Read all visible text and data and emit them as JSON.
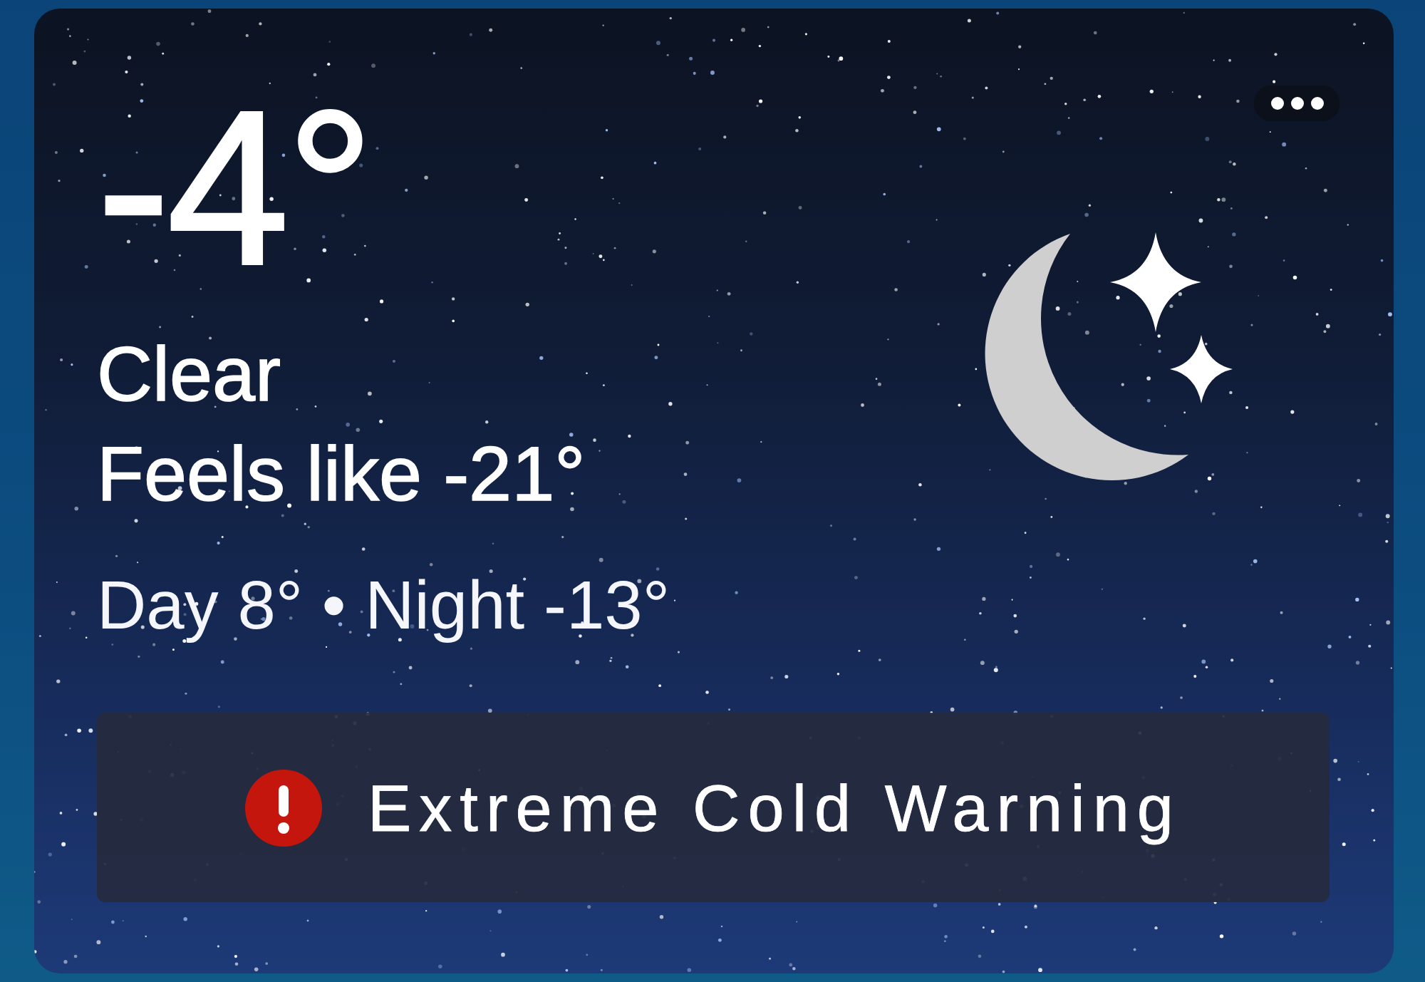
{
  "weather": {
    "temperature": "-4°",
    "condition": "Clear",
    "feels_like": "Feels like -21°",
    "day_night": "Day 8° • Night -13°"
  },
  "alert": {
    "title": "Extreme Cold Warning"
  }
}
